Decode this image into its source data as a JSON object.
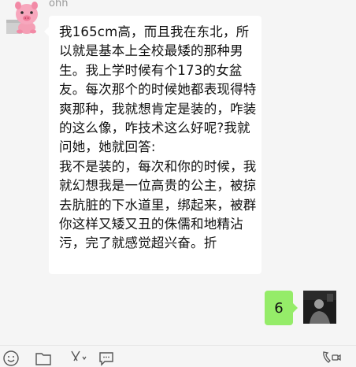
{
  "chat": {
    "sender_name": "ohh",
    "incoming_message": "我165cm高，而且我在东北，所以就是基本上全校最矮的那种男生。我上学时候有个173的女盆友。每次那个的时候她都表现得特爽那种，我就想肯定是装的，咋装的这么像，咋技术这么好呢?我就问她，她就回答:\n我不是装的，每次和你的时候，我就幻想我是一位高贵的公主，被掠去肮脏的下水道里，绑起来，被群你这样又矮又丑的侏儒和地精沾污，完了就感觉超兴奋。折",
    "outgoing_message": "6"
  },
  "colors": {
    "background": "#f5f5f5",
    "incoming_bubble": "#ffffff",
    "outgoing_bubble": "#95ec69"
  },
  "toolbar": {
    "icons": [
      "emoji-icon",
      "folder-icon",
      "scissors-icon",
      "chat-history-icon",
      "voice-call-icon"
    ]
  }
}
